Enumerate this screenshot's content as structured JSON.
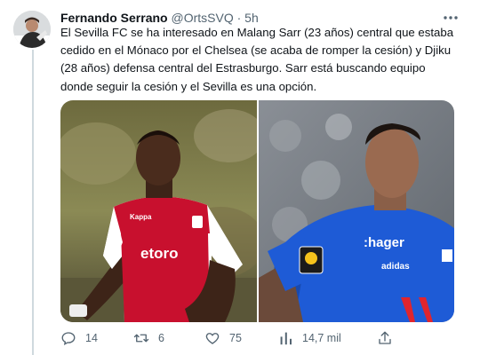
{
  "author": {
    "name": "Fernando Serrano",
    "handle": "@OrtsSVQ",
    "separator": "·",
    "time": "5h"
  },
  "tweet": {
    "lines": [
      "El Sevilla FC se ha interesado en Malang Sarr (23 años) central que estaba",
      "cedido en el Mónaco por el Chelsea (se acaba de romper la cesión) y Djiku",
      "(28 años) defensa central del Estrasburgo. Sarr está buscando equipo",
      "donde seguir la cesión y el Sevilla es una opción."
    ]
  },
  "media": {
    "left_photo": {
      "sponsor": "etoro",
      "badge": "kappa",
      "jersey_colors": [
        "#c8102e",
        "#ffffff"
      ]
    },
    "right_photo": {
      "sponsor": "hager",
      "jersey_color": "#1e5bd6",
      "badge": "adidas"
    }
  },
  "actions": {
    "replies": "14",
    "retweets": "6",
    "likes": "75",
    "views": "14,7 mil"
  },
  "icons": [
    "more-icon",
    "reply-icon",
    "retweet-icon",
    "like-icon",
    "views-icon",
    "share-icon"
  ],
  "colors": {
    "text": "#0f1419",
    "secondary": "#536471",
    "thread_line": "#cfd9de"
  }
}
